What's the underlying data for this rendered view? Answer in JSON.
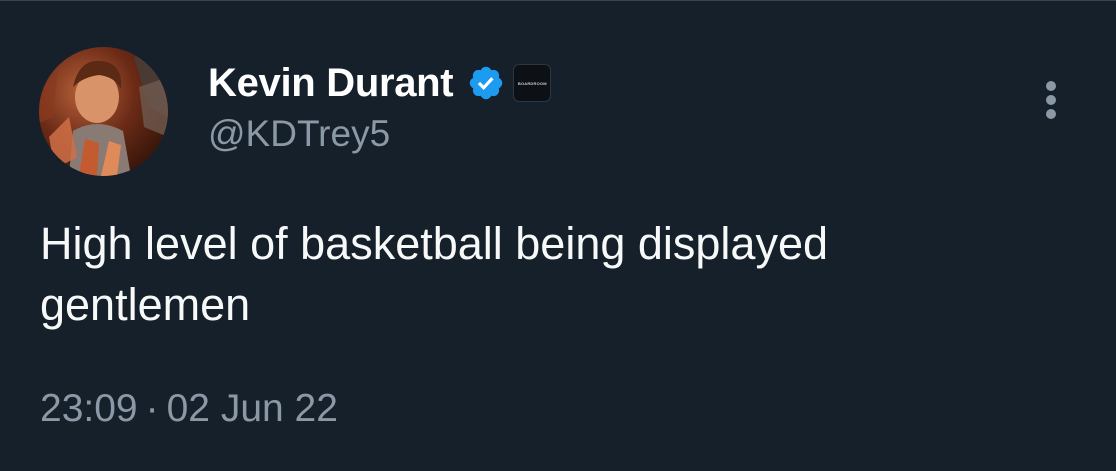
{
  "tweet": {
    "author": {
      "display_name": "Kevin Durant",
      "handle": "@KDTrey5",
      "verified": true,
      "verified_icon": "verified-badge-icon",
      "affiliate_badge_text": "BOARDROOM",
      "avatar": "profile-avatar"
    },
    "more_icon": "more-options-icon",
    "text_lines": [
      "High level of basketball being displayed",
      "gentlemen"
    ],
    "time": "23:09",
    "separator": "·",
    "date": "02 Jun 22"
  },
  "colors": {
    "background": "#15202b",
    "primary_text": "#f7f9f9",
    "secondary_text": "#8b98a5",
    "verified_blue": "#1d9bf0"
  }
}
